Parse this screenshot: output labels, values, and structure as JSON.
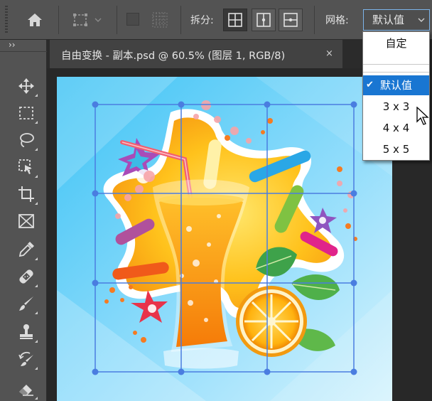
{
  "options_bar": {
    "split_label": "拆分:",
    "grid_label": "网格:",
    "grid_select_value": "默认值"
  },
  "document_tab": {
    "title": "自由变换 - 副本.psd @ 60.5% (图层 1, RGB/8)",
    "close_glyph": "×"
  },
  "tool_panel": {
    "collapse_glyph": "››",
    "tools": [
      "move-tool",
      "rectangular-marquee-tool",
      "lasso-tool",
      "object-selection-tool",
      "crop-tool",
      "frame-tool",
      "eyedropper-tool",
      "spot-healing-brush-tool",
      "brush-tool",
      "clone-stamp-tool",
      "history-brush-tool",
      "eraser-tool"
    ]
  },
  "grid_dropdown": {
    "options": [
      "自定",
      "默认值",
      "3 x 3",
      "4 x 4",
      "5 x 5"
    ],
    "selected": "默认值",
    "check_glyph": "✔"
  },
  "colors": {
    "accent": "#1976d2",
    "panel": "#535353",
    "canvas_bg": "#282828",
    "transform_grid": "#4a7de0"
  }
}
